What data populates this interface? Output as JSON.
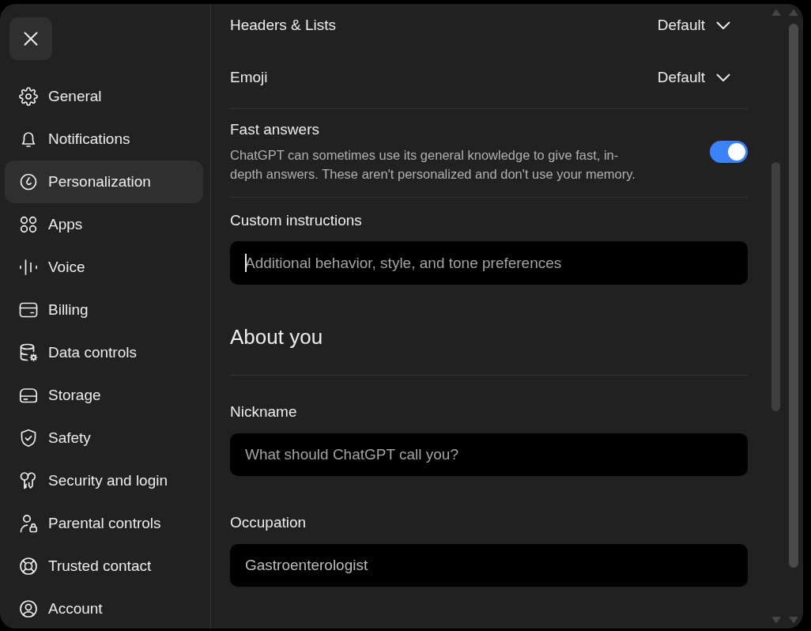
{
  "sidebar": {
    "items": [
      {
        "label": "General",
        "selected": false
      },
      {
        "label": "Notifications",
        "selected": false
      },
      {
        "label": "Personalization",
        "selected": true
      },
      {
        "label": "Apps",
        "selected": false
      },
      {
        "label": "Voice",
        "selected": false
      },
      {
        "label": "Billing",
        "selected": false
      },
      {
        "label": "Data controls",
        "selected": false
      },
      {
        "label": "Storage",
        "selected": false
      },
      {
        "label": "Safety",
        "selected": false
      },
      {
        "label": "Security and login",
        "selected": false
      },
      {
        "label": "Parental controls",
        "selected": false
      },
      {
        "label": "Trusted contact",
        "selected": false
      },
      {
        "label": "Account",
        "selected": false
      }
    ]
  },
  "preferences": [
    {
      "kind": "select",
      "label": "Headers & Lists",
      "value": "Default"
    },
    {
      "kind": "select",
      "label": "Emoji",
      "value": "Default"
    },
    {
      "kind": "toggle",
      "label": "Fast answers",
      "description": "ChatGPT can sometimes use its general knowledge to give fast, in-depth answers. These aren't personalized and don't use your memory.",
      "on": true
    }
  ],
  "custom_instructions": {
    "label": "Custom instructions",
    "placeholder": "Additional behavior, style, and tone preferences",
    "focused": true
  },
  "about_you": {
    "heading": "About you",
    "fields": [
      {
        "label": "Nickname",
        "placeholder": "What should ChatGPT call you?"
      },
      {
        "label": "Occupation",
        "value": "Gastroenterologist"
      }
    ]
  }
}
